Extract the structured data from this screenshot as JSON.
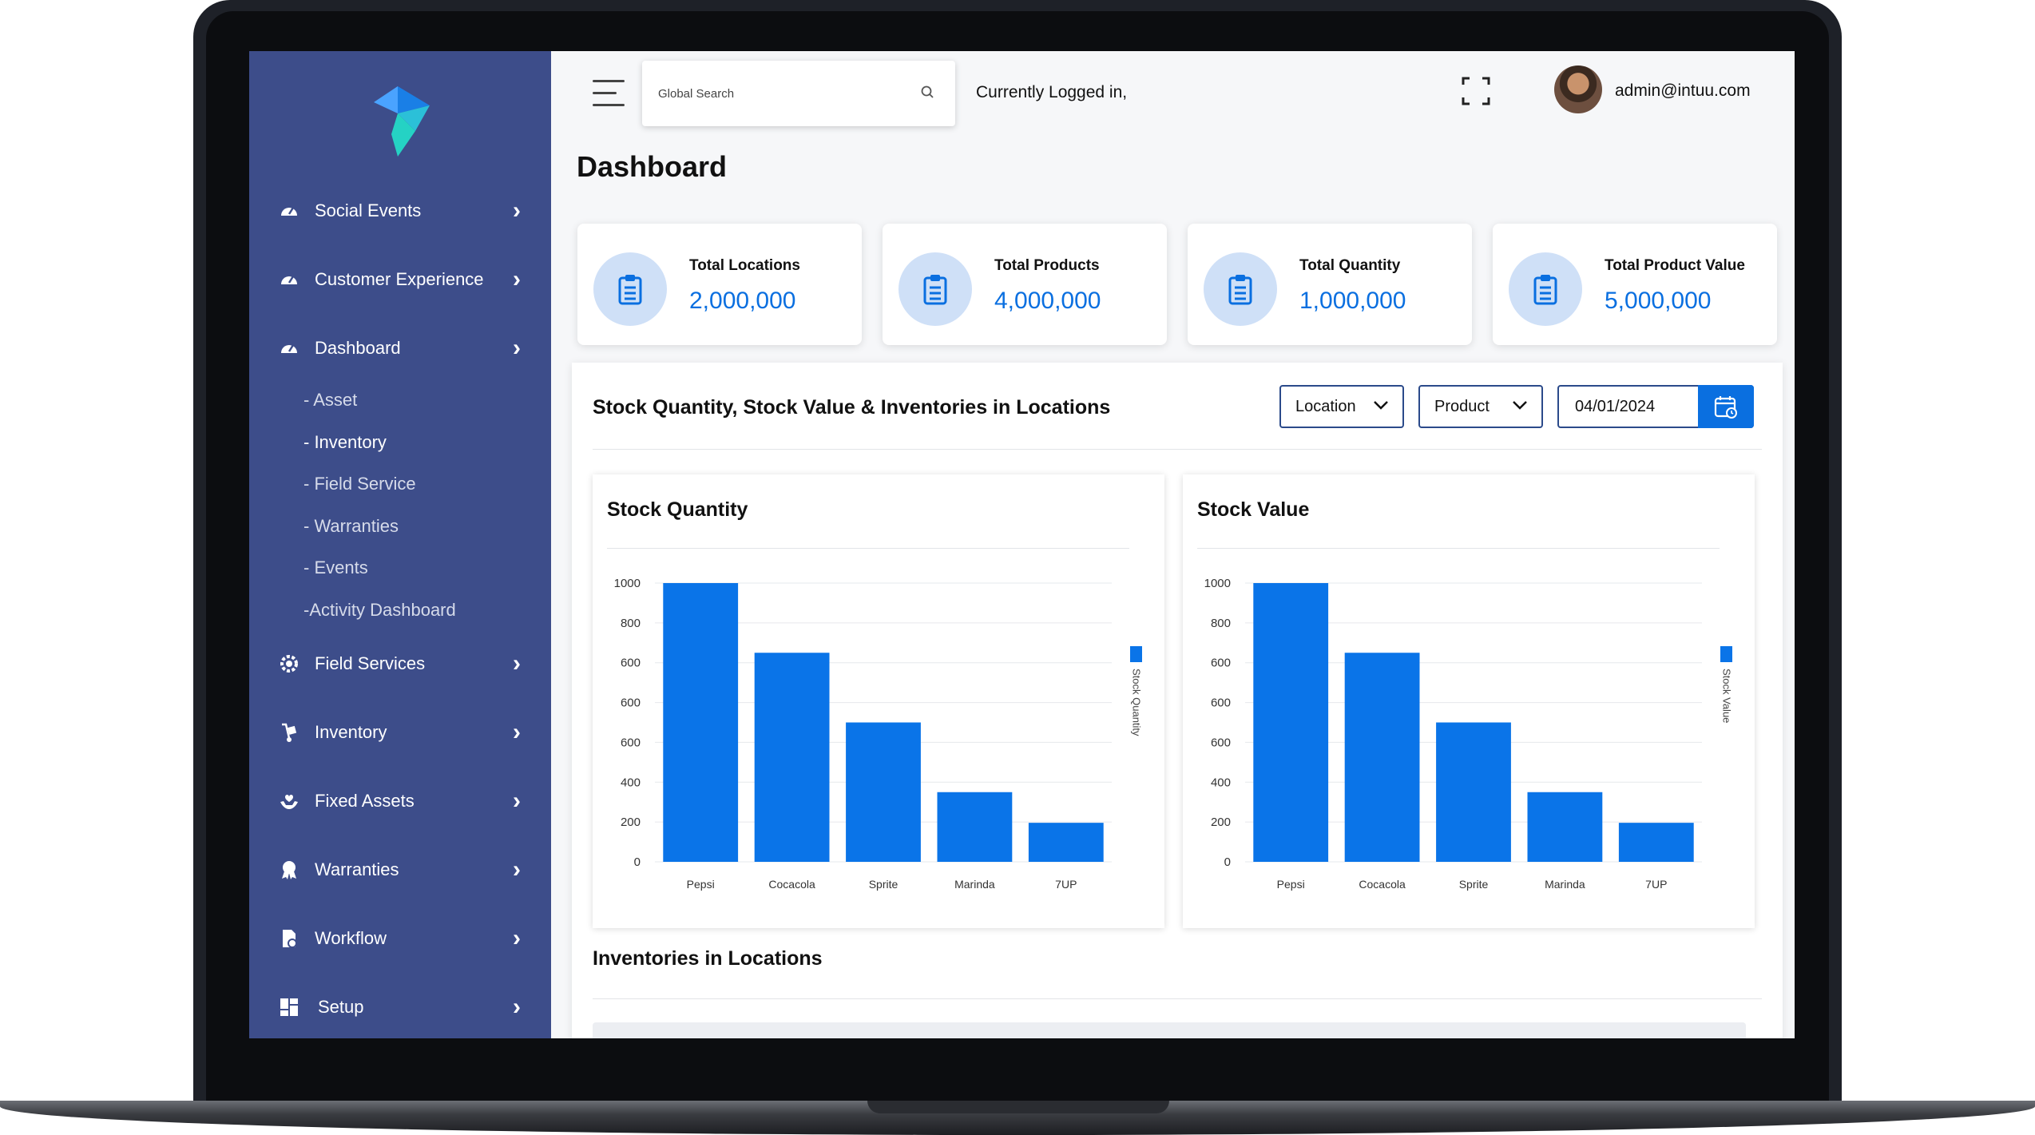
{
  "search": {
    "placeholder": "Global Search"
  },
  "header": {
    "logged_in_text": "Currently Logged in,",
    "user_email": "admin@intuu.com"
  },
  "page": {
    "title": "Dashboard"
  },
  "sidebar": {
    "items": [
      {
        "label": "Social Events",
        "icon": "speedometer-icon"
      },
      {
        "label": "Customer Experience",
        "icon": "speedometer-icon"
      },
      {
        "label": "Dashboard",
        "icon": "speedometer-icon"
      },
      {
        "label": "Field Services",
        "icon": "gear-icon"
      },
      {
        "label": "Inventory",
        "icon": "hand-truck-icon"
      },
      {
        "label": "Fixed Assets",
        "icon": "hand-heart-icon"
      },
      {
        "label": "Warranties",
        "icon": "award-icon"
      },
      {
        "label": "Workflow",
        "icon": "document-flow-icon"
      },
      {
        "label": "Setup",
        "icon": "grid-icon"
      }
    ],
    "sub_items": [
      "- Asset",
      "- Inventory",
      "- Field Service",
      "- Warranties",
      "- Events",
      "-Activity Dashboard"
    ],
    "active_sub_item": "- Inventory"
  },
  "kpis": [
    {
      "label": "Total Locations",
      "value": "2,000,000",
      "icon": "clipboard-icon"
    },
    {
      "label": "Total Products",
      "value": "4,000,000",
      "icon": "clipboard-icon"
    },
    {
      "label": "Total Quantity",
      "value": "1,000,000",
      "icon": "clipboard-icon"
    },
    {
      "label": "Total Product Value",
      "value": "5,000,000",
      "icon": "clipboard-icon"
    }
  ],
  "panel": {
    "title": "Stock Quantity, Stock Value & Inventories in Locations",
    "filters": {
      "location": "Location",
      "product": "Product",
      "date": "04/01/2024"
    },
    "section_title": "Inventories in Locations"
  },
  "colors": {
    "sidebar": "#3d4d8a",
    "accent": "#0a6fe0",
    "bar": "#0a74e8",
    "kpi_icon_bg": "#cfe0f7"
  },
  "chart_data": [
    {
      "type": "bar",
      "title": "Stock Quantity",
      "categories": [
        "Pepsi",
        "Cocacola",
        "Sprite",
        "Marinda",
        "7UP"
      ],
      "series": [
        {
          "name": "Stock Quantity",
          "values": [
            1000,
            750,
            500,
            250,
            140
          ]
        }
      ],
      "y_tick_labels": [
        "0",
        "200",
        "400",
        "600",
        "600",
        "600",
        "800",
        "1000"
      ],
      "ylim": [
        0,
        1000
      ],
      "grid": true,
      "legend_position": "right"
    },
    {
      "type": "bar",
      "title": "Stock Value",
      "categories": [
        "Pepsi",
        "Cocacola",
        "Sprite",
        "Marinda",
        "7UP"
      ],
      "series": [
        {
          "name": "Stock Value",
          "values": [
            1000,
            750,
            500,
            250,
            140
          ]
        }
      ],
      "y_tick_labels": [
        "0",
        "200",
        "400",
        "600",
        "600",
        "600",
        "800",
        "1000"
      ],
      "ylim": [
        0,
        1000
      ],
      "grid": true,
      "legend_position": "right"
    }
  ]
}
